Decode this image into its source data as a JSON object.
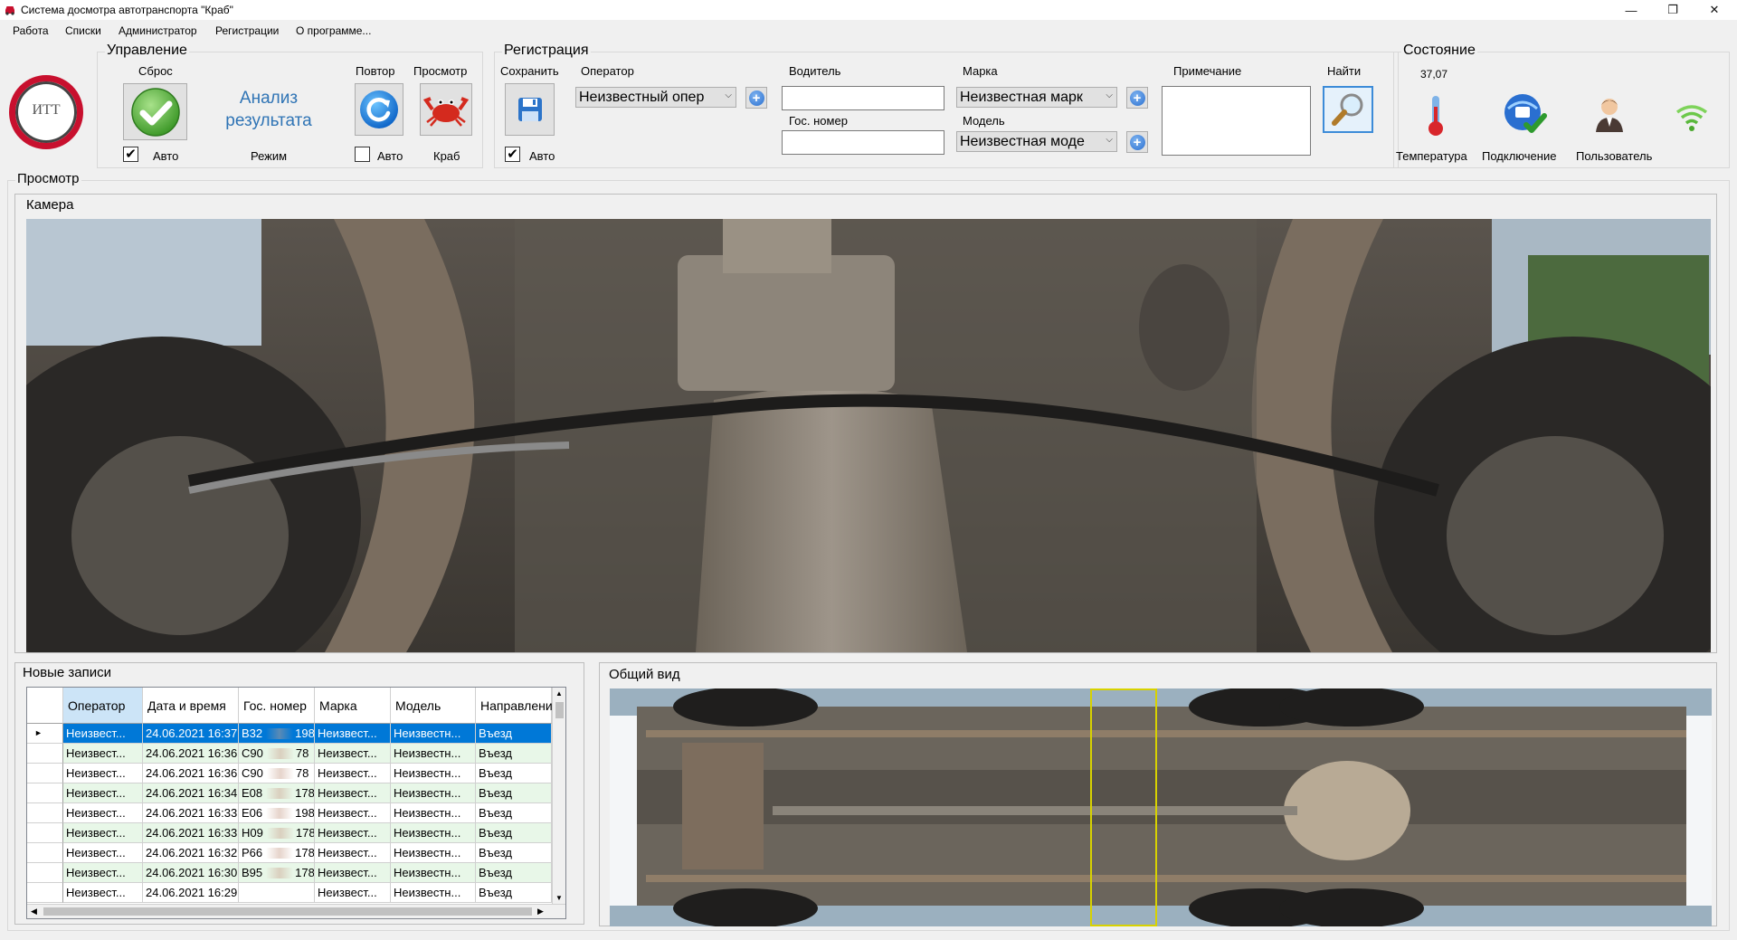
{
  "window": {
    "title": "Система досмотра автотранспорта \"Краб\"",
    "minimize": "—",
    "restore": "❐",
    "close": "✕"
  },
  "menu": [
    "Работа",
    "Списки",
    "Администратор",
    "Регистрации",
    "О программе..."
  ],
  "control": {
    "title": "Управление",
    "logo_text": "ИТТ",
    "reset_label": "Сброс",
    "auto_label": "Авто",
    "auto_checked": true,
    "analysis_text": "Анализ результата",
    "mode_label": "Режим",
    "repeat_label": "Повтор",
    "view_label": "Просмотр",
    "auto2_label": "Авто",
    "auto2_checked": false,
    "crab_label": "Краб"
  },
  "registration": {
    "title": "Регистрация",
    "save_label": "Сохранить",
    "auto_label": "Авто",
    "auto_checked": true,
    "operator_label": "Оператор",
    "operator_value": "Неизвестный опер",
    "driver_label": "Водитель",
    "driver_value": "",
    "plate_label": "Гос. номер",
    "plate_value": "",
    "brand_label": "Марка",
    "brand_value": "Неизвестная марк",
    "model_label": "Модель",
    "model_value": "Неизвестная моде",
    "note_label": "Примечание",
    "note_value": "",
    "find_label": "Найти"
  },
  "status": {
    "title": "Состояние",
    "temperature_value": "37,07",
    "temperature_label": "Температура",
    "connection_label": "Подключение",
    "user_label": "Пользователь"
  },
  "view": {
    "title": "Просмотр",
    "camera_label": "Камера",
    "records_label": "Новые записи",
    "overview_label": "Общий вид"
  },
  "grid": {
    "columns": [
      "Оператор",
      "Дата и время",
      "Гос. номер",
      "Марка",
      "Модель",
      "Направлени"
    ],
    "rows": [
      {
        "operator": "Неизвест...",
        "datetime": "24.06.2021 16:37",
        "plate": "В32",
        "region": "198",
        "brand": "Неизвест...",
        "model": "Неизвестн...",
        "direction": "Въезд",
        "selected": true
      },
      {
        "operator": "Неизвест...",
        "datetime": "24.06.2021 16:36",
        "plate": "С90",
        "region": "78",
        "brand": "Неизвест...",
        "model": "Неизвестн...",
        "direction": "Въезд"
      },
      {
        "operator": "Неизвест...",
        "datetime": "24.06.2021 16:36",
        "plate": "С90",
        "region": "78",
        "brand": "Неизвест...",
        "model": "Неизвестн...",
        "direction": "Въезд"
      },
      {
        "operator": "Неизвест...",
        "datetime": "24.06.2021 16:34",
        "plate": "Е08",
        "region": "178",
        "brand": "Неизвест...",
        "model": "Неизвестн...",
        "direction": "Въезд"
      },
      {
        "operator": "Неизвест...",
        "datetime": "24.06.2021 16:33",
        "plate": "Е06",
        "region": "198",
        "brand": "Неизвест...",
        "model": "Неизвестн...",
        "direction": "Въезд"
      },
      {
        "operator": "Неизвест...",
        "datetime": "24.06.2021 16:33",
        "plate": "Н09",
        "region": "178",
        "brand": "Неизвест...",
        "model": "Неизвестн...",
        "direction": "Въезд"
      },
      {
        "operator": "Неизвест...",
        "datetime": "24.06.2021 16:32",
        "plate": "Р66",
        "region": "178",
        "brand": "Неизвест...",
        "model": "Неизвестн...",
        "direction": "Въезд"
      },
      {
        "operator": "Неизвест...",
        "datetime": "24.06.2021 16:30",
        "plate": "В95",
        "region": "178",
        "brand": "Неизвест...",
        "model": "Неизвестн...",
        "direction": "Въезд"
      },
      {
        "operator": "Неизвест...",
        "datetime": "24.06.2021 16:29",
        "plate": "",
        "region": "",
        "brand": "Неизвест...",
        "model": "Неизвестн...",
        "direction": "Въезд"
      }
    ]
  },
  "colors": {
    "selected_row": "#0078d7",
    "alt_row": "#e8f7e8",
    "logo_red": "#c8102e",
    "analysis_blue": "#2f74b5",
    "highlight_box": "#d8d200"
  }
}
